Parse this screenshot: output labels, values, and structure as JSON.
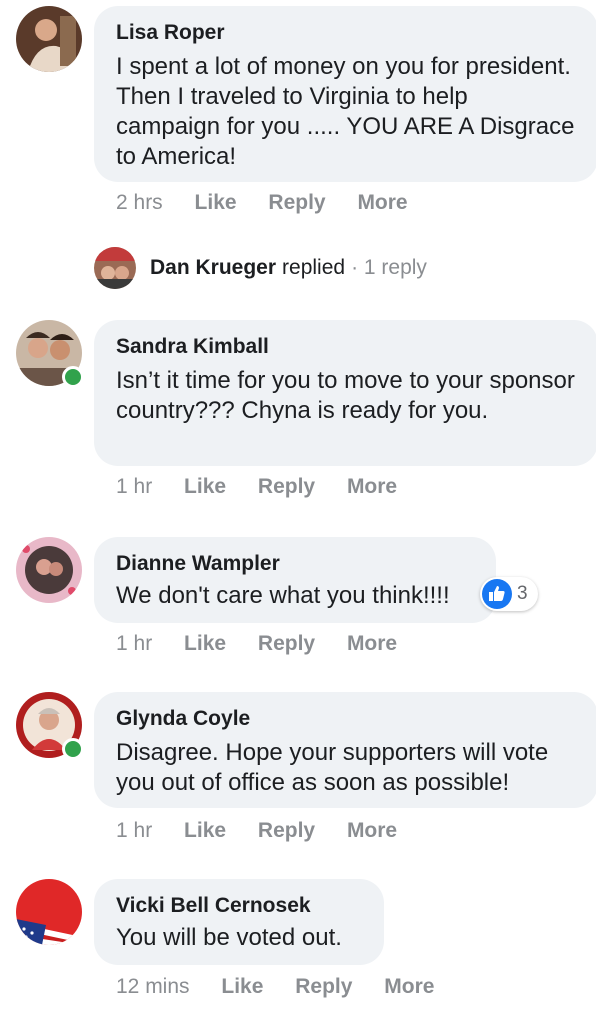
{
  "comments": [
    {
      "name": "Lisa Roper",
      "text": "I spent a lot of money on you for president. Then I traveled to Virginia to help campaign for you ..... YOU ARE A Disgrace to America!",
      "time": "2 hrs",
      "online": false
    },
    {
      "name": "Sandra Kimball",
      "text": "Isn’t it time for you to move to your sponsor country??? Chyna is ready for you.",
      "time": "1 hr",
      "online": true
    },
    {
      "name": "Dianne Wampler",
      "text": "We don't care what you think!!!!",
      "time": "1 hr",
      "online": false,
      "reaction_count": "3"
    },
    {
      "name": "Glynda Coyle",
      "text": "Disagree. Hope your supporters will vote you out of office as soon as possible!",
      "time": "1 hr",
      "online": true
    },
    {
      "name": "Vicki Bell Cernosek",
      "text": "You will be voted out.",
      "time": "12 mins",
      "online": false
    }
  ],
  "actions": {
    "like": "Like",
    "reply": "Reply",
    "more": "More"
  },
  "reply_thread": {
    "name": "Dan Krueger",
    "verb": "replied",
    "count": "· 1 reply"
  },
  "colors": {
    "bubble": "#eff2f5",
    "meta": "#8a8d91",
    "online": "#31a24c",
    "like": "#1877f2"
  }
}
